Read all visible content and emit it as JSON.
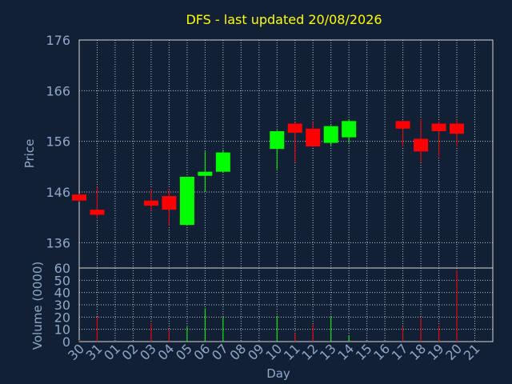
{
  "chart_data": [
    {
      "type": "candlestick",
      "title": "DFS - last updated 20/08/2026",
      "ylabel": "Price",
      "ylim": [
        131,
        176
      ],
      "yticks": [
        136,
        146,
        156,
        166,
        176
      ],
      "grid": true,
      "colors": {
        "up": "#00ff00",
        "down": "#ff0000",
        "background": "#122035",
        "title": "#ffff00",
        "axis_text": "#8fa8c8"
      },
      "candles": [
        {
          "day": "30",
          "open": 145.5,
          "high": 145.6,
          "low": 144.1,
          "close": 144.3
        },
        {
          "day": "31",
          "open": 142.5,
          "high": 147.0,
          "low": 140.8,
          "close": 141.5
        },
        {
          "day": "03",
          "open": 144.3,
          "high": 146.6,
          "low": 142.3,
          "close": 143.3
        },
        {
          "day": "04",
          "open": 145.2,
          "high": 146.6,
          "low": 139.4,
          "close": 142.5
        },
        {
          "day": "05",
          "open": 139.5,
          "high": 149.0,
          "low": 139.4,
          "close": 149.0
        },
        {
          "day": "06",
          "open": 149.2,
          "high": 154.0,
          "low": 146.0,
          "close": 150.0
        },
        {
          "day": "07",
          "open": 150.0,
          "high": 154.3,
          "low": 149.9,
          "close": 153.8
        },
        {
          "day": "10",
          "open": 154.5,
          "high": 158.2,
          "low": 150.5,
          "close": 158.0
        },
        {
          "day": "11",
          "open": 159.5,
          "high": 159.8,
          "low": 151.9,
          "close": 157.7
        },
        {
          "day": "12",
          "open": 158.5,
          "high": 159.8,
          "low": 154.9,
          "close": 155.0
        },
        {
          "day": "13",
          "open": 155.7,
          "high": 159.2,
          "low": 155.0,
          "close": 159.0
        },
        {
          "day": "14",
          "open": 156.8,
          "high": 160.3,
          "low": 155.7,
          "close": 160.0
        },
        {
          "day": "17",
          "open": 160.0,
          "high": 160.1,
          "low": 155.0,
          "close": 158.5
        },
        {
          "day": "18",
          "open": 156.5,
          "high": 160.4,
          "low": 151.9,
          "close": 154.0
        },
        {
          "day": "19",
          "open": 159.5,
          "high": 159.9,
          "low": 153.0,
          "close": 158.0
        },
        {
          "day": "20",
          "open": 159.5,
          "high": 160.3,
          "low": 155.0,
          "close": 157.5
        }
      ]
    },
    {
      "type": "bar",
      "ylabel": "Volume (0000)",
      "ylim": [
        0,
        60
      ],
      "yticks": [
        0,
        10,
        20,
        30,
        40,
        50,
        60
      ],
      "xlabel": "Day",
      "grid": true,
      "categories": [
        "30",
        "31",
        "01",
        "02",
        "03",
        "04",
        "05",
        "06",
        "07",
        "08",
        "09",
        "10",
        "11",
        "12",
        "13",
        "14",
        "15",
        "16",
        "17",
        "18",
        "19",
        "20",
        "21"
      ],
      "bars": [
        {
          "day": "30",
          "value": 1,
          "direction": "down"
        },
        {
          "day": "31",
          "value": 20,
          "direction": "down"
        },
        {
          "day": "03",
          "value": 15,
          "direction": "down"
        },
        {
          "day": "04",
          "value": 10,
          "direction": "down"
        },
        {
          "day": "05",
          "value": 12,
          "direction": "up"
        },
        {
          "day": "06",
          "value": 27,
          "direction": "up"
        },
        {
          "day": "07",
          "value": 20,
          "direction": "up"
        },
        {
          "day": "10",
          "value": 21,
          "direction": "up"
        },
        {
          "day": "11",
          "value": 7,
          "direction": "down"
        },
        {
          "day": "12",
          "value": 14,
          "direction": "down"
        },
        {
          "day": "13",
          "value": 21,
          "direction": "up"
        },
        {
          "day": "14",
          "value": 5,
          "direction": "up"
        },
        {
          "day": "17",
          "value": 12,
          "direction": "down"
        },
        {
          "day": "18",
          "value": 19,
          "direction": "down"
        },
        {
          "day": "19",
          "value": 13,
          "direction": "down"
        },
        {
          "day": "20",
          "value": 58,
          "direction": "down"
        }
      ]
    }
  ]
}
